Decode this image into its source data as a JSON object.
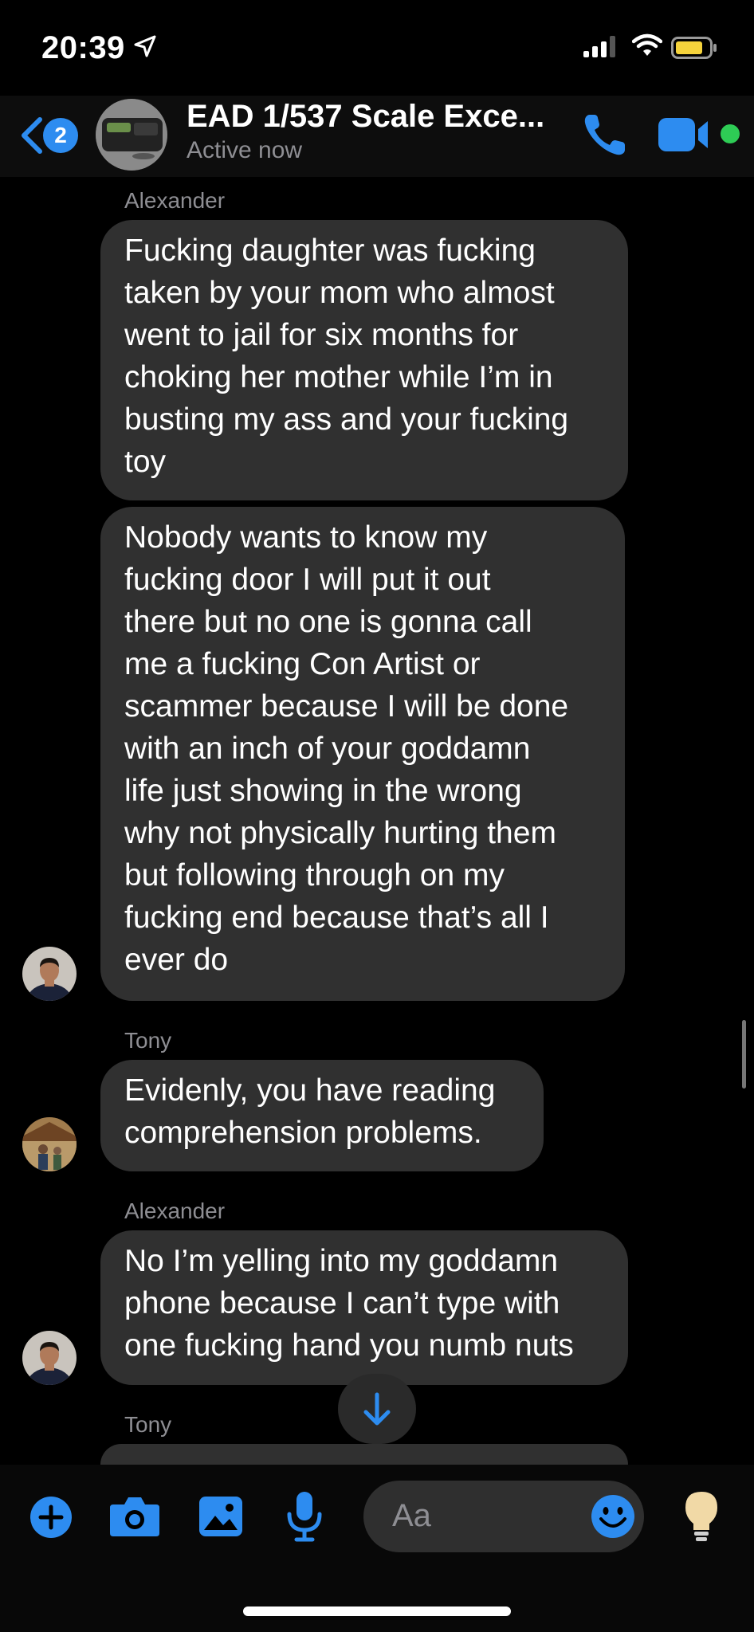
{
  "status_bar": {
    "time": "20:39"
  },
  "header": {
    "back_badge": "2",
    "title": "EAD 1/537  Scale Exce...",
    "subtitle": "Active now"
  },
  "messages": [
    {
      "sender": "Alexander",
      "text": "Fucking daughter was fucking\ntaken by your mom who almost\nwent to jail for six months for\nchoking her mother while I’m in\nbusting my ass and your fucking\ntoy"
    },
    {
      "text": "Nobody wants to know my\nfucking door I will put it out\nthere but no one is gonna call\nme a fucking Con Artist or\nscammer because I will be done\nwith an inch of your goddamn\nlife just showing in the wrong\nwhy not physically hurting them\nbut following through on my\nfucking end because that’s all I\never do"
    },
    {
      "sender": "Tony",
      "text": "Evidenly, you have reading\ncomprehension problems."
    },
    {
      "sender": "Alexander",
      "text": "No I’m yelling into my goddamn\nphone because I can’t type with\none fucking hand you numb nuts"
    },
    {
      "sender": "Tony",
      "text": ""
    }
  ],
  "composer": {
    "placeholder": "Aa"
  },
  "colors": {
    "accent": "#2d8cf0",
    "bubble": "#303030",
    "active": "#2ecc55"
  }
}
